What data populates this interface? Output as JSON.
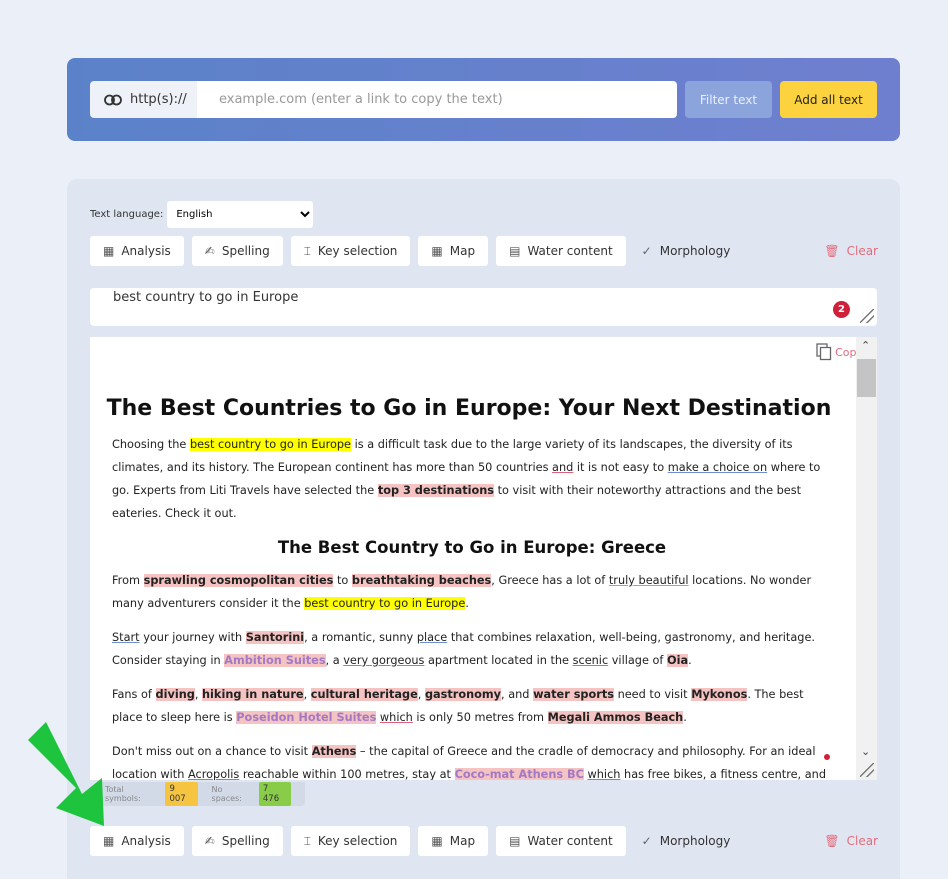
{
  "url_bar": {
    "prefix": "http(s)://",
    "placeholder": "example.com (enter a link to copy the text)",
    "filter_label": "Filter text",
    "add_label": "Add all text"
  },
  "language": {
    "label": "Text language:",
    "selected": "English"
  },
  "toolbar": {
    "analysis": "Analysis",
    "spelling": "Spelling",
    "key_selection": "Key selection",
    "map": "Map",
    "water_content": "Water content",
    "morphology": "Morphology",
    "clear": "Clear"
  },
  "keyword": {
    "text": "best country to go in Europe",
    "count": "2"
  },
  "article": {
    "copy_label": "Copy",
    "title": "The Best Countries to Go in Europe: Your Next Destination",
    "h2": "The Best Country to Go in Europe: Greece",
    "p1": {
      "a": "Choosing the ",
      "kw": "best country to go in Europe",
      "b": " is a difficult task due to the large variety of its landscapes, the diversity of its climates, and its history. The European continent has more than 50 countries ",
      "and": "and",
      "c": " it is not easy to ",
      "make": "make a choice on",
      "d": " where to go. Experts from Liti Travels have selected the ",
      "top": "top 3 destinations",
      "e": " to visit with their noteworthy attractions and the best eateries. Check it out."
    },
    "p2": {
      "a": "From ",
      "sprawl": "sprawling cosmopolitan cities",
      "b": " to ",
      "beach": "breathtaking beaches",
      "c": ", Greece has a lot of ",
      "truly": "truly beautiful",
      "d": " locations. No wonder many adventurers consider it the ",
      "kw": "best country to go in Europe",
      "e": "."
    },
    "p3": {
      "start": "Start",
      "a": " your journey with ",
      "santorini": "Santorini",
      "b": ", a romantic, sunny ",
      "place": "place",
      "c": " that combines relaxation, well-being, gastronomy, and heritage. Consider staying in ",
      "ambition": "Ambition Suites",
      "d": ", a ",
      "gorgeous": "very gorgeous",
      "e": " apartment located in the ",
      "scenic": "scenic",
      "f": " village of ",
      "oia": "Oia",
      "g": "."
    },
    "p4": {
      "a": "Fans of ",
      "diving": "diving",
      "hiking": "hiking in nature",
      "cultural": "cultural heritage",
      "gastronomy": "gastronomy",
      "b": ", and ",
      "water": "water sports",
      "c": " need to visit ",
      "mykonos": "Mykonos",
      "d": ". The best place to sleep here is ",
      "poseidon": "Poseidon Hotel Suites",
      "which": "which",
      "e": " is only 50 metres from ",
      "megali": "Megali Ammos Beach",
      "f": "."
    },
    "p5": {
      "a": "Don't miss out on a chance to visit ",
      "athens": "Athens",
      "b": " – the capital of Greece and the cradle of democracy and philosophy. For an ideal location with ",
      "acropolis": "Acropolis",
      "c": " reachable within 100 metres, stay at ",
      "coco": "Coco-mat Athens BC",
      "which": "which",
      "d": " has free bikes, a fitness centre, and a sauna."
    }
  },
  "counts": {
    "total_label": "Total symbols:",
    "total_value": "9 007",
    "nospace_label": "No spaces:",
    "nospace_value": "7 476"
  },
  "colors": {
    "accent_yellow": "#fcd33f",
    "keyword_highlight": "#ffff00",
    "phrase_highlight": "#f6c3c3",
    "arrow": "#1ec43e",
    "clear_red": "#e36d7d"
  }
}
